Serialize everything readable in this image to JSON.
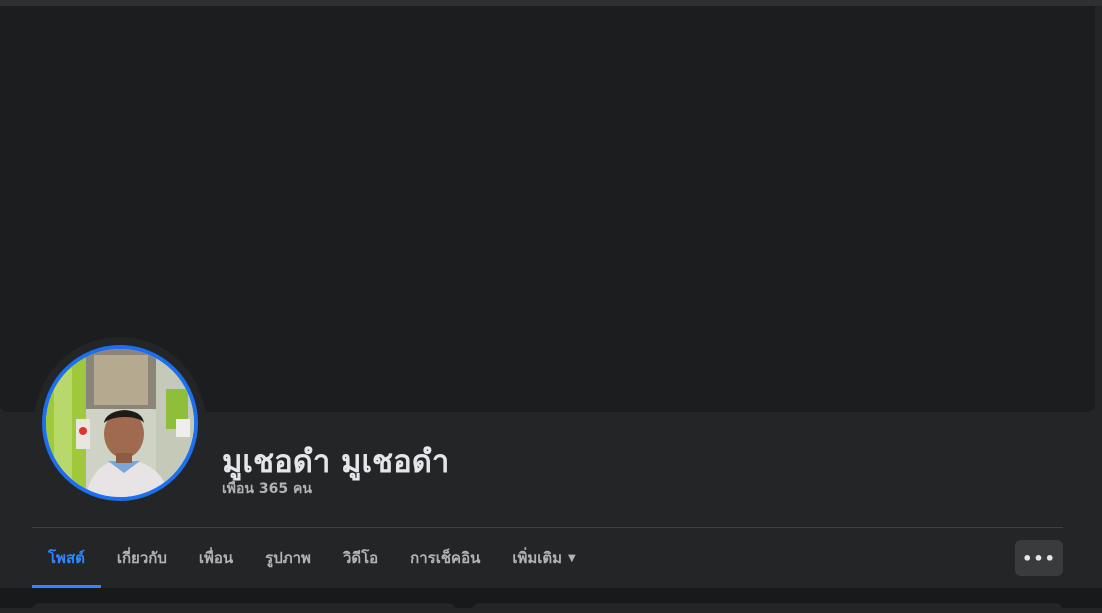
{
  "profile": {
    "name": "มูเชอดำ มูเชอดำ",
    "friends_count": "เพื่อน 365 คน"
  },
  "tabs": [
    {
      "label": "โพสต์",
      "active": true
    },
    {
      "label": "เกี่ยวกับ",
      "active": false
    },
    {
      "label": "เพื่อน",
      "active": false
    },
    {
      "label": "รูปภาพ",
      "active": false
    },
    {
      "label": "วิดีโอ",
      "active": false
    },
    {
      "label": "การเช็คอิน",
      "active": false
    },
    {
      "label": "เพิ่มเติม",
      "active": false
    }
  ],
  "more_button": {
    "icon": "more-horizontal-icon",
    "label": "•••"
  },
  "colors": {
    "accent": "#2d88ff",
    "avatar_ring": "#1b6ff0",
    "background": "#242526",
    "cover": "#1c1d1f"
  }
}
